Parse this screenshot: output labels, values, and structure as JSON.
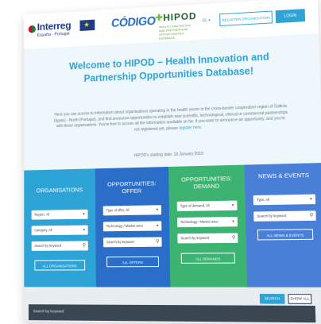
{
  "header": {
    "interreg_name": "Interreg",
    "interreg_region": "España - Portugal",
    "codigo": "CÓDIGO",
    "hipod": "HIPOD",
    "hipod_tagline": "HEALTH INNOVATION AND PARTNERSHIP OPPORTUNITIES DATABASE",
    "language": "GL ▾",
    "register_label": "REGISTER ORGANISATION",
    "login_label": "LOGIN"
  },
  "hero": {
    "title": "Welcome to HIPOD – Health Innovation and Partnership Opportunities Database!",
    "body": "Here you can access to information about organisations operating in the health sector in the cross-border cooperation region of Galicia (Spain) - North (Portugal), and find announce opportunities to establish new scientific, technological, clinical or commercial partnerships with these organisations. You're free to access all the information available so far. If you want to announce an opportunity, and you're not registered yet, please",
    "body_link": "register here",
    "date": "HIPOD's starting date: 18 January 2019"
  },
  "columns": [
    {
      "title": "ORGANISATIONS",
      "color": "#2ea3d6",
      "fields": [
        {
          "label": "Region, All",
          "kind": "select"
        },
        {
          "label": "Category, All",
          "kind": "select"
        },
        {
          "label": "Search by keyword",
          "kind": "search"
        }
      ],
      "button": "ALL ORGANISATIONS"
    },
    {
      "title": "OPPORTUNITIES: OFFER",
      "color": "#2a6ec9",
      "fields": [
        {
          "label": "Type of offer, All",
          "kind": "select"
        },
        {
          "label": "Technology / Market area",
          "kind": "select"
        },
        {
          "label": "Search by keyword",
          "kind": "search"
        }
      ],
      "button": "ALL OFFERS"
    },
    {
      "title": "OPPORTUNITIES: DEMAND",
      "color": "#3cb371",
      "fields": [
        {
          "label": "Type of demand, All",
          "kind": "select"
        },
        {
          "label": "Technology / Market area",
          "kind": "select"
        },
        {
          "label": "Search by keyword",
          "kind": "search"
        }
      ],
      "button": "ALL DEMANDS"
    },
    {
      "title": "NEWS & EVENTS",
      "color": "#4a7fd8",
      "fields": [
        {
          "label": "Type, All",
          "kind": "select"
        },
        {
          "label": "Search by keyword",
          "kind": "search"
        }
      ],
      "button": "ALL NEWS & EVENTS"
    }
  ],
  "bottom": {
    "search_label": "SEARCH",
    "show_all_label": "SHOW ALL",
    "keyword_placeholder": "Search by keyword"
  }
}
